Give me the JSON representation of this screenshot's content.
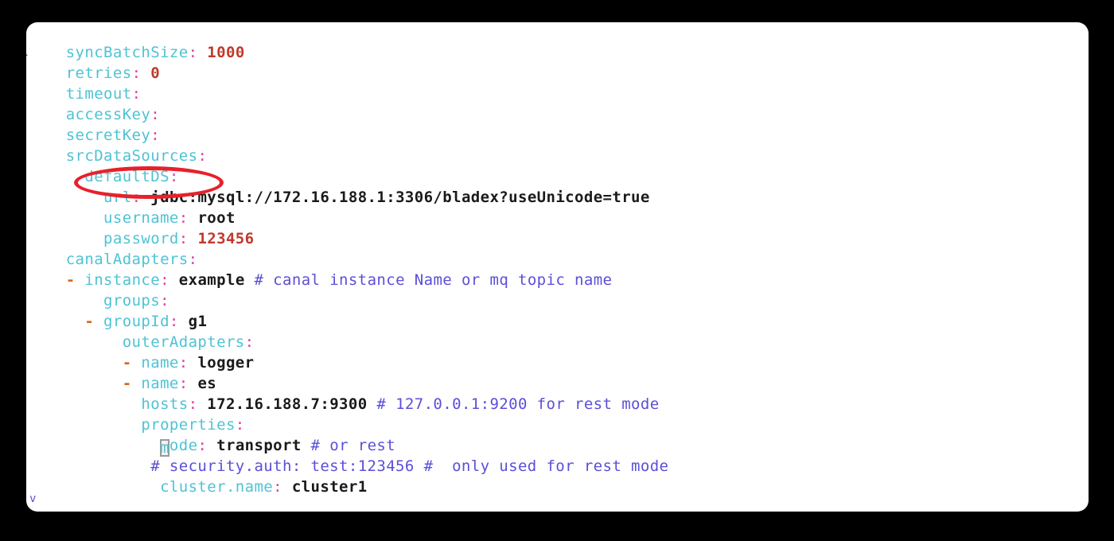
{
  "annotation": {
    "type": "ellipse-highlight",
    "color": "#e8202a",
    "target_text": "defaultDS:"
  },
  "editor": {
    "background": "#ffffff",
    "page_background": "#000000",
    "language": "yaml",
    "cursor_char": "m",
    "colors": {
      "key": "#4ec3d4",
      "colon": "#e0409f",
      "value": "#1a1a1a",
      "number": "#c0392b",
      "comment": "#5b4fd8",
      "dash": "#d2691e"
    },
    "edge_artifacts": {
      "top": "}",
      "bottom": "v"
    }
  },
  "code": {
    "lines": [
      {
        "indent": "  ",
        "key": "syncBatchSize",
        "value": "1000",
        "value_type": "number"
      },
      {
        "indent": "  ",
        "key": "retries",
        "value": "0",
        "value_type": "number"
      },
      {
        "indent": "  ",
        "key": "timeout",
        "value": "",
        "value_type": "none"
      },
      {
        "indent": "  ",
        "key": "accessKey",
        "value": "",
        "value_type": "none"
      },
      {
        "indent": "  ",
        "key": "secretKey",
        "value": "",
        "value_type": "none"
      },
      {
        "indent": "  ",
        "key": "srcDataSources",
        "value": "",
        "value_type": "none"
      },
      {
        "indent": "    ",
        "key": "defaultDS",
        "value": "",
        "value_type": "none"
      },
      {
        "indent": "      ",
        "key": "url",
        "value": "jdbc:mysql://172.16.188.1:3306/bladex?useUnicode=true",
        "value_type": "text"
      },
      {
        "indent": "      ",
        "key": "username",
        "value": "root",
        "value_type": "text"
      },
      {
        "indent": "      ",
        "key": "password",
        "value": "123456",
        "value_type": "number"
      },
      {
        "indent": "  ",
        "key": "canalAdapters",
        "value": "",
        "value_type": "none"
      },
      {
        "indent": "  ",
        "dash": "-",
        "key": "instance",
        "value": "example",
        "value_type": "text",
        "comment": "# canal instance Name or mq topic name"
      },
      {
        "indent": "      ",
        "key": "groups",
        "value": "",
        "value_type": "none"
      },
      {
        "indent": "    ",
        "dash": "-",
        "key": "groupId",
        "value": "g1",
        "value_type": "text"
      },
      {
        "indent": "        ",
        "key": "outerAdapters",
        "value": "",
        "value_type": "none"
      },
      {
        "indent": "        ",
        "dash": "-",
        "key": "name",
        "value": "logger",
        "value_type": "text"
      },
      {
        "indent": "        ",
        "dash": "-",
        "key": "name",
        "value": "es",
        "value_type": "text"
      },
      {
        "indent": "          ",
        "key": "hosts",
        "value": "172.16.188.7:9300",
        "value_type": "text",
        "comment": "# 127.0.0.1:9200 for rest mode"
      },
      {
        "indent": "          ",
        "key": "properties",
        "value": "",
        "value_type": "none"
      },
      {
        "indent": "            ",
        "key": "mode",
        "value": "transport",
        "value_type": "text",
        "comment": "# or rest",
        "cursor_on_key": true
      },
      {
        "indent": "           ",
        "comment_only": "# security.auth: test:123456 #  only used for rest mode"
      },
      {
        "indent": "            ",
        "key": "cluster.name",
        "value": "cluster1",
        "value_type": "text"
      }
    ]
  }
}
